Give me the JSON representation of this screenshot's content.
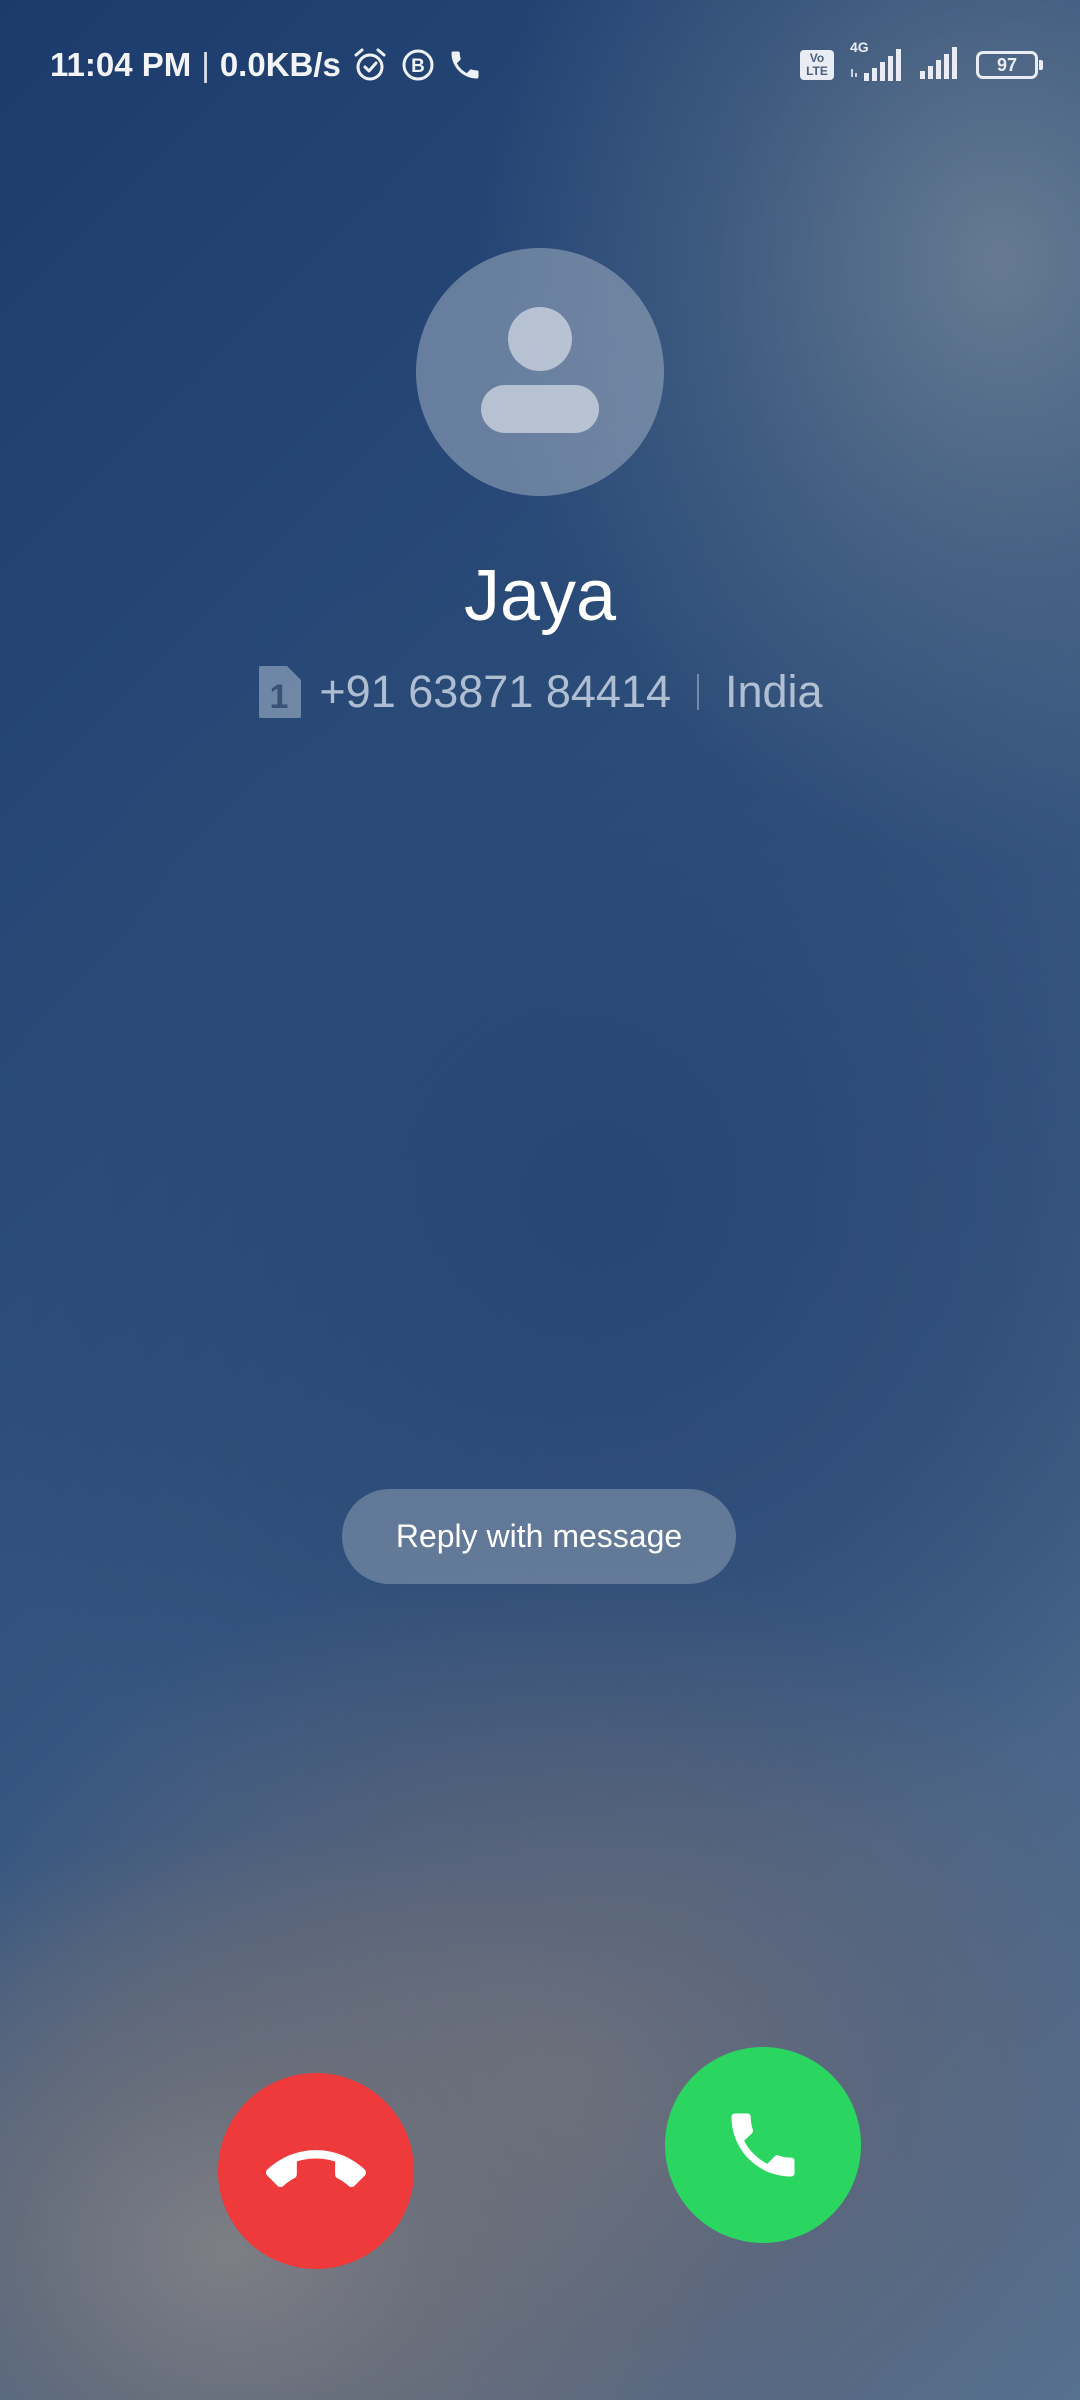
{
  "status_bar": {
    "time": "11:04 PM",
    "separator": "|",
    "network_speed": "0.0KB/s",
    "left_icons": [
      "alarm-icon",
      "b-badge-icon",
      "phone-icon"
    ],
    "volte_label_top": "Vo",
    "volte_label_bottom": "LTE",
    "network_type": "4G",
    "battery_level": "97"
  },
  "caller": {
    "name": "Jaya",
    "sim_slot": "1",
    "number": "+91 63871 84414",
    "location": "India"
  },
  "actions": {
    "reply_label": "Reply with message",
    "decline_icon": "hang-up-icon",
    "answer_icon": "phone-icon"
  },
  "colors": {
    "decline": "#ee3a3a",
    "answer": "#2bd660"
  }
}
